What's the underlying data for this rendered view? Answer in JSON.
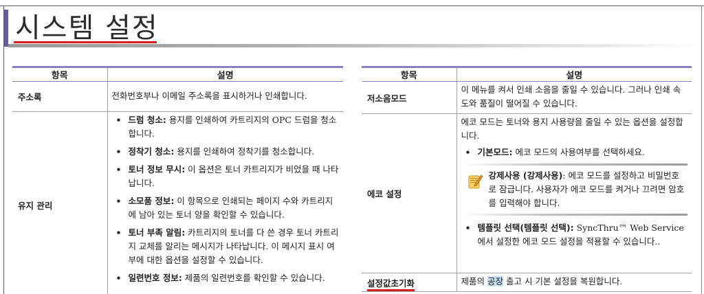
{
  "page": {
    "title": "시스템 설정"
  },
  "left_table": {
    "headers": {
      "item": "항목",
      "desc": "설명"
    },
    "rows": [
      {
        "item": "주소록",
        "desc": "전화번호부나 이메일 주소록을 표시하거나 인쇄합니다."
      },
      {
        "item": "유지 관리",
        "bullets": [
          {
            "term": "드럼 청소:",
            "text": " 용지를 인쇄하여 카트리지의 OPC 드럼을 청소합니다."
          },
          {
            "term": "정착기 청소:",
            "text": " 용지를 인쇄하여 정착기를 청소합니다."
          },
          {
            "term": "토너 정보 무시:",
            "text": " 이 옵션은 토너 카트리지가 비었을 때 나타납니다."
          },
          {
            "term": "소모품 정보:",
            "text": " 이 항목으로 인쇄되는 페이지 수와 카트리지에 남아 있는 토너 양을 확인할 수 있습니다."
          },
          {
            "term": "토너 부족 알림:",
            "text": " 카트리지의 토너를 다 쓴 경우 토너 카트리지 교체를 알리는 메시지가 나타납니다. 이 메시지 표시 여부에 대한 옵션을 설정할 수 있습니다."
          },
          {
            "term": "일련번호 정보:",
            "text": " 제품의 일련번호를 확인할 수 있습니다."
          }
        ]
      }
    ]
  },
  "right_table": {
    "headers": {
      "item": "항목",
      "desc": "설명"
    },
    "rows": [
      {
        "item": "저소음모드",
        "desc": "이 메뉴를 켜서 인쇄 소음을 줄일 수 있습니다. 그러나 인쇄 속도와 품질이 떨어질 수 있습니다."
      },
      {
        "item": "에코 설정",
        "intro": "에코 모드는 토너와 용지 사용량을 줄일 수 있는 옵션을 설정합니다.",
        "bullet1": {
          "term": "기본모드:",
          "text": " 에코 모드의 사용여부를 선택하세요."
        },
        "note": {
          "term": "강제사용 (강제사용)",
          "text": ": 에코 모드를 설정하고 비밀번호로 잠급니다. 사용자가 에코 모드를 켜거나 끄려면 암호를 입력해야 합니다."
        },
        "bullet2": {
          "term": "템플릿 선택(템플릿 선택):",
          "text": " SyncThru™ Web Service에서 설정한 에코 모드 설정을 적용할 수 있습니다.."
        }
      },
      {
        "item": "설정값초기화",
        "desc_before": "제품의 ",
        "desc_highlight": "공장",
        "desc_after": " 출고 시 기본 설정을 복원합니다."
      }
    ]
  },
  "colors": {
    "accent": "#6a5aa6",
    "header_rule": "#8d7fc6",
    "underline": "#d61f1f",
    "highlight": "#c7e3f2",
    "note_icon": "#f2b233"
  },
  "icons": {
    "note": "note-pencil-icon"
  }
}
